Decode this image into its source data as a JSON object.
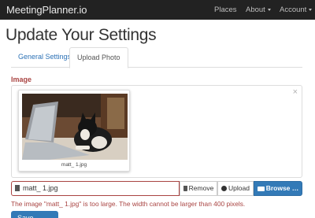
{
  "navbar": {
    "brand": "MeetingPlanner.io",
    "items": [
      {
        "label": "Places"
      },
      {
        "label": "About"
      },
      {
        "label": "Account"
      }
    ],
    "bg_color": "#222222"
  },
  "page": {
    "title": "Update Your Settings"
  },
  "tabs": [
    {
      "label": "General Settings",
      "active": false
    },
    {
      "label": "Upload Photo",
      "active": true
    }
  ],
  "form": {
    "image_label": "Image",
    "thumbnail_caption": "matt_ 1.jpg",
    "file_input_value": "matt_ 1.jpg",
    "buttons": {
      "remove": "Remove",
      "upload": "Upload",
      "browse": "Browse …",
      "save": "Save Settings"
    },
    "error_message": "The image \"matt_ 1.jpg\" is too large. The width cannot be larger than 400 pixels.",
    "close_symbol": "×"
  },
  "colors": {
    "accent": "#337ab7",
    "error": "#a94442",
    "link": "#2d72b6"
  },
  "icons": [
    "file-icon",
    "trash-icon",
    "upload-icon",
    "folder-open-icon",
    "close-icon",
    "caret-down-icon"
  ]
}
